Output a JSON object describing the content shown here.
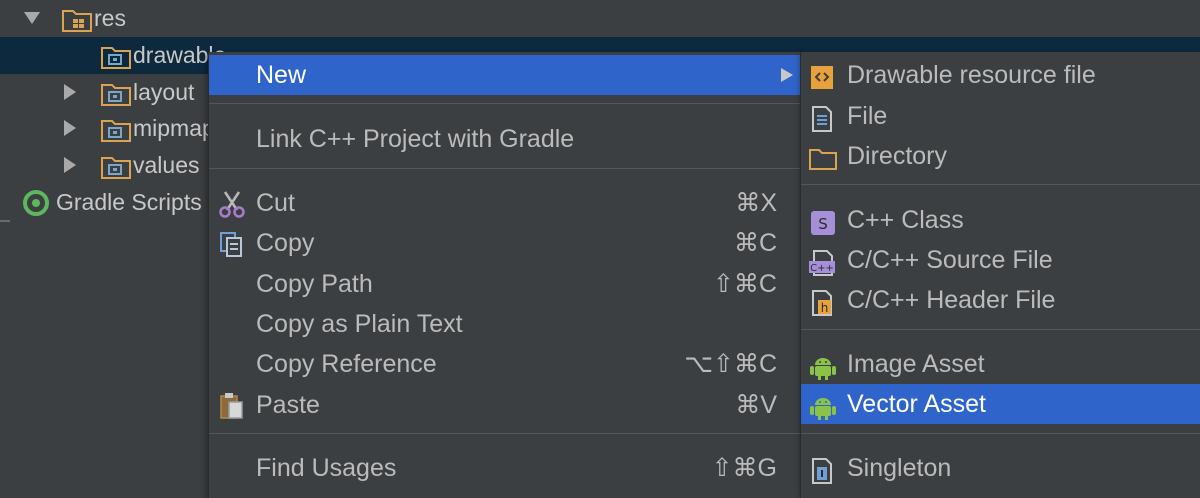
{
  "tree": {
    "res_label": "res",
    "drawable_label": "drawable",
    "layout_label": "layout",
    "mipmap_label": "mipmap",
    "values_label": "values",
    "gradle_label": "Gradle Scripts"
  },
  "menu": {
    "new_label": "New",
    "link_cpp_label": "Link C++ Project with Gradle",
    "cut_label": "Cut",
    "cut_shortcut": "⌘X",
    "copy_label": "Copy",
    "copy_shortcut": "⌘C",
    "copy_path_label": "Copy Path",
    "copy_path_shortcut": "⇧⌘C",
    "copy_plain_label": "Copy as Plain Text",
    "copy_reference_label": "Copy Reference",
    "copy_reference_shortcut": "⌥⇧⌘C",
    "paste_label": "Paste",
    "paste_shortcut": "⌘V",
    "find_usages_label": "Find Usages",
    "find_usages_shortcut": "⇧⌘G"
  },
  "submenu": {
    "drawable_resource_label": "Drawable resource file",
    "file_label": "File",
    "directory_label": "Directory",
    "cpp_class_label": "C++ Class",
    "cpp_source_label": "C/C++ Source File",
    "cpp_header_label": "C/C++ Header File",
    "image_asset_label": "Image Asset",
    "vector_asset_label": "Vector Asset",
    "singleton_label": "Singleton"
  },
  "icons": {
    "cpp_class_letter": "S",
    "cpp_source_text": "C++",
    "cpp_header_letter": "h"
  },
  "colors": {
    "background": "#3c3f41",
    "highlight": "#2f65ca",
    "tree_selection": "#0d293e",
    "folder": "#d9a451",
    "android_green": "#8bc34a"
  }
}
